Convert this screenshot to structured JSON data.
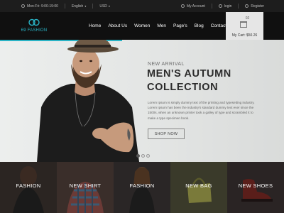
{
  "topbar": {
    "hours": "Mon-Fri: 9:00-19:00",
    "language": "English",
    "currency": "USD",
    "account": "My Account",
    "login": "login",
    "register": "Register"
  },
  "header": {
    "logo_text": "69 FASHION",
    "nav": [
      "Home",
      "About Us",
      "Women",
      "Men",
      "Page's",
      "Blog",
      "Contact"
    ],
    "cart": {
      "count": "02",
      "total": "My Cart: $50.26"
    }
  },
  "hero": {
    "kicker": "NEW ARRIVAL",
    "title_line1": "MEN'S AUTUMN",
    "title_line2": "COLLECTION",
    "body": "Lorem Ipsum is simply dummy text of the printing and typesetting industry. Lorem Ipsum has been the industry's standard dummy text ever since the 1500s, when an unknown printer took a galley of type and scrambled it to make a type specimen book.",
    "button": "SHOP NOW"
  },
  "categories": [
    "FASHION",
    "NEW SHIRT",
    "FASHION",
    "NEW BAG",
    "NEW SHOES"
  ],
  "colors": {
    "accent": "#29b3c5",
    "header_bg": "#101010",
    "topbar_bg": "#1d1d1d"
  }
}
